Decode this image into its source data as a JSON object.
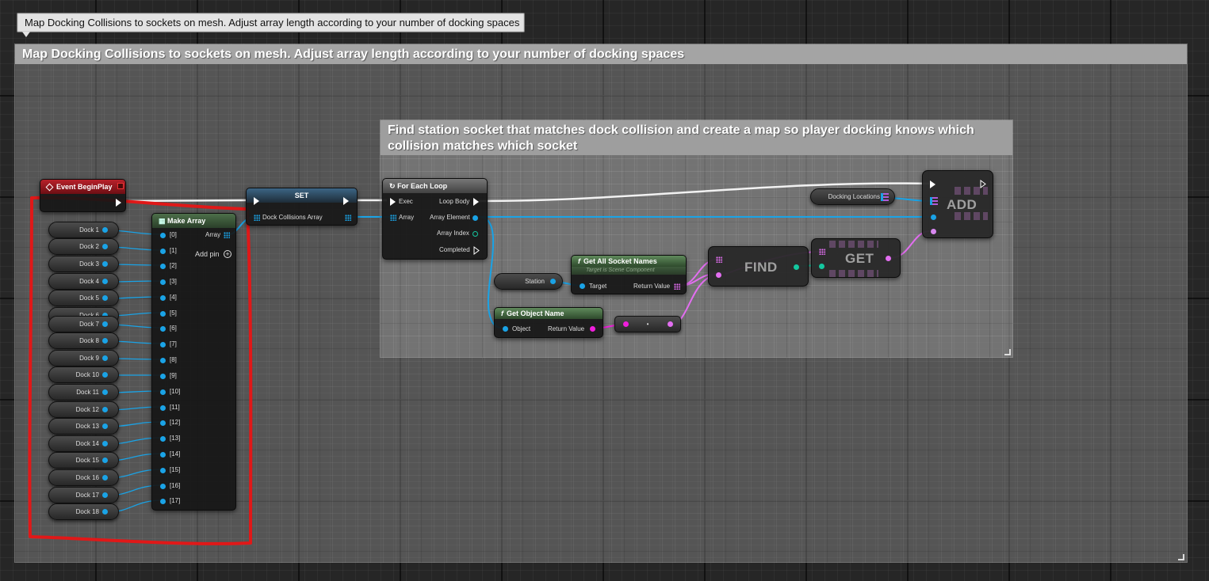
{
  "tooltip": "Map Docking Collisions to sockets on mesh. Adjust array length according to your number of docking spaces",
  "outer_comment": {
    "title": "Map Docking Collisions to sockets on mesh. Adjust array length according to your number of docking spaces"
  },
  "inner_comment": {
    "title": "Find station socket that matches dock collision and create a map so player docking knows which collision matches which socket"
  },
  "event_node": {
    "title": "Event BeginPlay"
  },
  "make_array": {
    "title": "Make Array",
    "output_label": "Array",
    "add_pin_label": "Add pin",
    "add_pin_icon": "plus-circle-icon",
    "pins": [
      "[0]",
      "[1]",
      "[2]",
      "[3]",
      "[4]",
      "[5]",
      "[6]",
      "[7]",
      "[8]",
      "[9]",
      "[10]",
      "[11]",
      "[12]",
      "[13]",
      "[14]",
      "[15]",
      "[16]",
      "[17]"
    ]
  },
  "docks": [
    "Dock 1",
    "Dock 2",
    "Dock 3",
    "Dock 4",
    "Dock 5",
    "Dock 6",
    "Dock 7",
    "Dock 8",
    "Dock 9",
    "Dock 10",
    "Dock 11",
    "Dock 12",
    "Dock 13",
    "Dock 14",
    "Dock 15",
    "Dock 16",
    "Dock 17",
    "Dock 18"
  ],
  "set_node": {
    "title": "SET",
    "pin_label": "Dock Collisions Array"
  },
  "foreach_node": {
    "title": "For Each Loop",
    "exec_in": "Exec",
    "array_in": "Array",
    "loop_body": "Loop Body",
    "array_element": "Array Element",
    "array_index": "Array Index",
    "completed": "Completed"
  },
  "station_var": "Station",
  "docking_locations_var": "Docking Locations",
  "get_all_socket_names": {
    "title": "Get All Socket Names",
    "subtitle": "Target is Scene Component",
    "target": "Target",
    "return_value": "Return Value"
  },
  "get_object_name": {
    "title": "Get Object Name",
    "object": "Object",
    "return_value": "Return Value"
  },
  "conversion_node": {
    "label": "•"
  },
  "find_node": {
    "title": "FIND"
  },
  "get_node": {
    "title": "GET"
  },
  "add_node": {
    "title": "ADD"
  },
  "colors": {
    "object_pin": "#1aa3e6",
    "name_pin": "#e26ef0",
    "string_pin": "#f01edc",
    "int_pin": "#14c8a0",
    "exec_pin": "#ffffff",
    "highlight": "#e01818",
    "event_header": "#b8212a",
    "pure_func_header": "#5f8a5b"
  }
}
